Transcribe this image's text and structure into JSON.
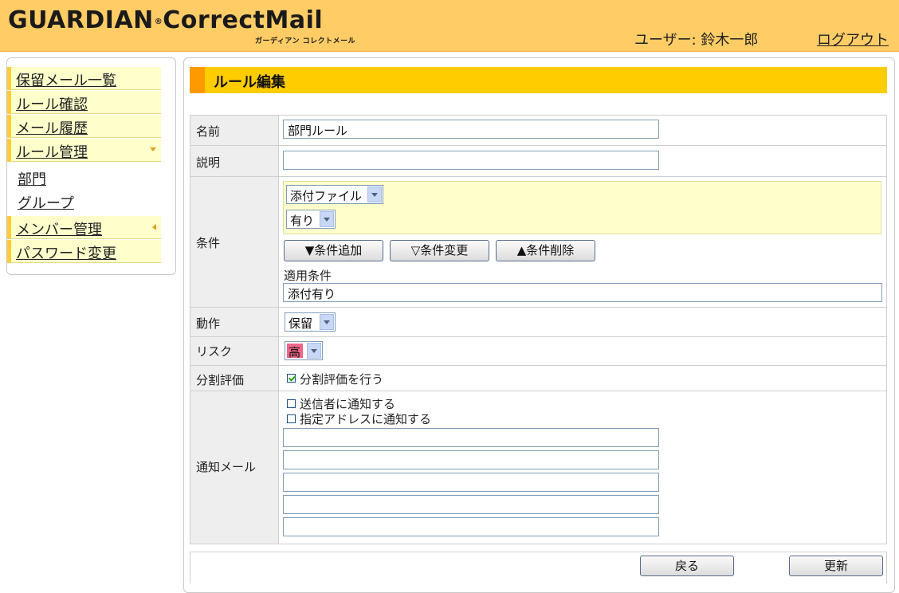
{
  "header": {
    "logo": "GUARDIAN",
    "logo_mark": "®",
    "logo_product": "CorrectMail",
    "logo_sub": "ガーディアン コレクトメール",
    "user_label": "ユーザー: 鈴木一郎",
    "logout": "ログアウト"
  },
  "sidebar": {
    "items": [
      {
        "label": "保留メール一覧"
      },
      {
        "label": "ルール確認"
      },
      {
        "label": "メール履歴"
      },
      {
        "label": "ルール管理"
      },
      {
        "label": "部門"
      },
      {
        "label": "グループ"
      },
      {
        "label": "メンバー管理"
      },
      {
        "label": "パスワード変更"
      }
    ]
  },
  "page": {
    "title": "ルール編集"
  },
  "form": {
    "name": {
      "label": "名前",
      "value": "部門ルール"
    },
    "description": {
      "label": "説明",
      "value": ""
    },
    "condition": {
      "label": "条件",
      "type_select": "添付ファイル",
      "value_select": "有り",
      "add_button": "▼条件追加",
      "change_button": "▽条件変更",
      "delete_button": "▲条件削除",
      "applied_label": "適用条件",
      "applied_value": "添付有り"
    },
    "action": {
      "label": "動作",
      "value": "保留"
    },
    "risk": {
      "label": "リスク",
      "value": "高",
      "color": "#ee6688"
    },
    "split": {
      "label": "分割評価",
      "checkbox_label": "分割評価を行う",
      "checked": true
    },
    "notify": {
      "label": "通知メール",
      "sender_label": "送信者に通知する",
      "sender_checked": false,
      "address_label": "指定アドレスに通知する",
      "address_checked": false,
      "addresses": [
        "",
        "",
        "",
        "",
        ""
      ]
    }
  },
  "footer": {
    "back": "戻る",
    "update": "更新"
  },
  "colors": {
    "header": "#ffcc66",
    "title_bar": "#ffcc00",
    "title_mark": "#ff9900",
    "sidebar_item": "#ffffcc"
  }
}
